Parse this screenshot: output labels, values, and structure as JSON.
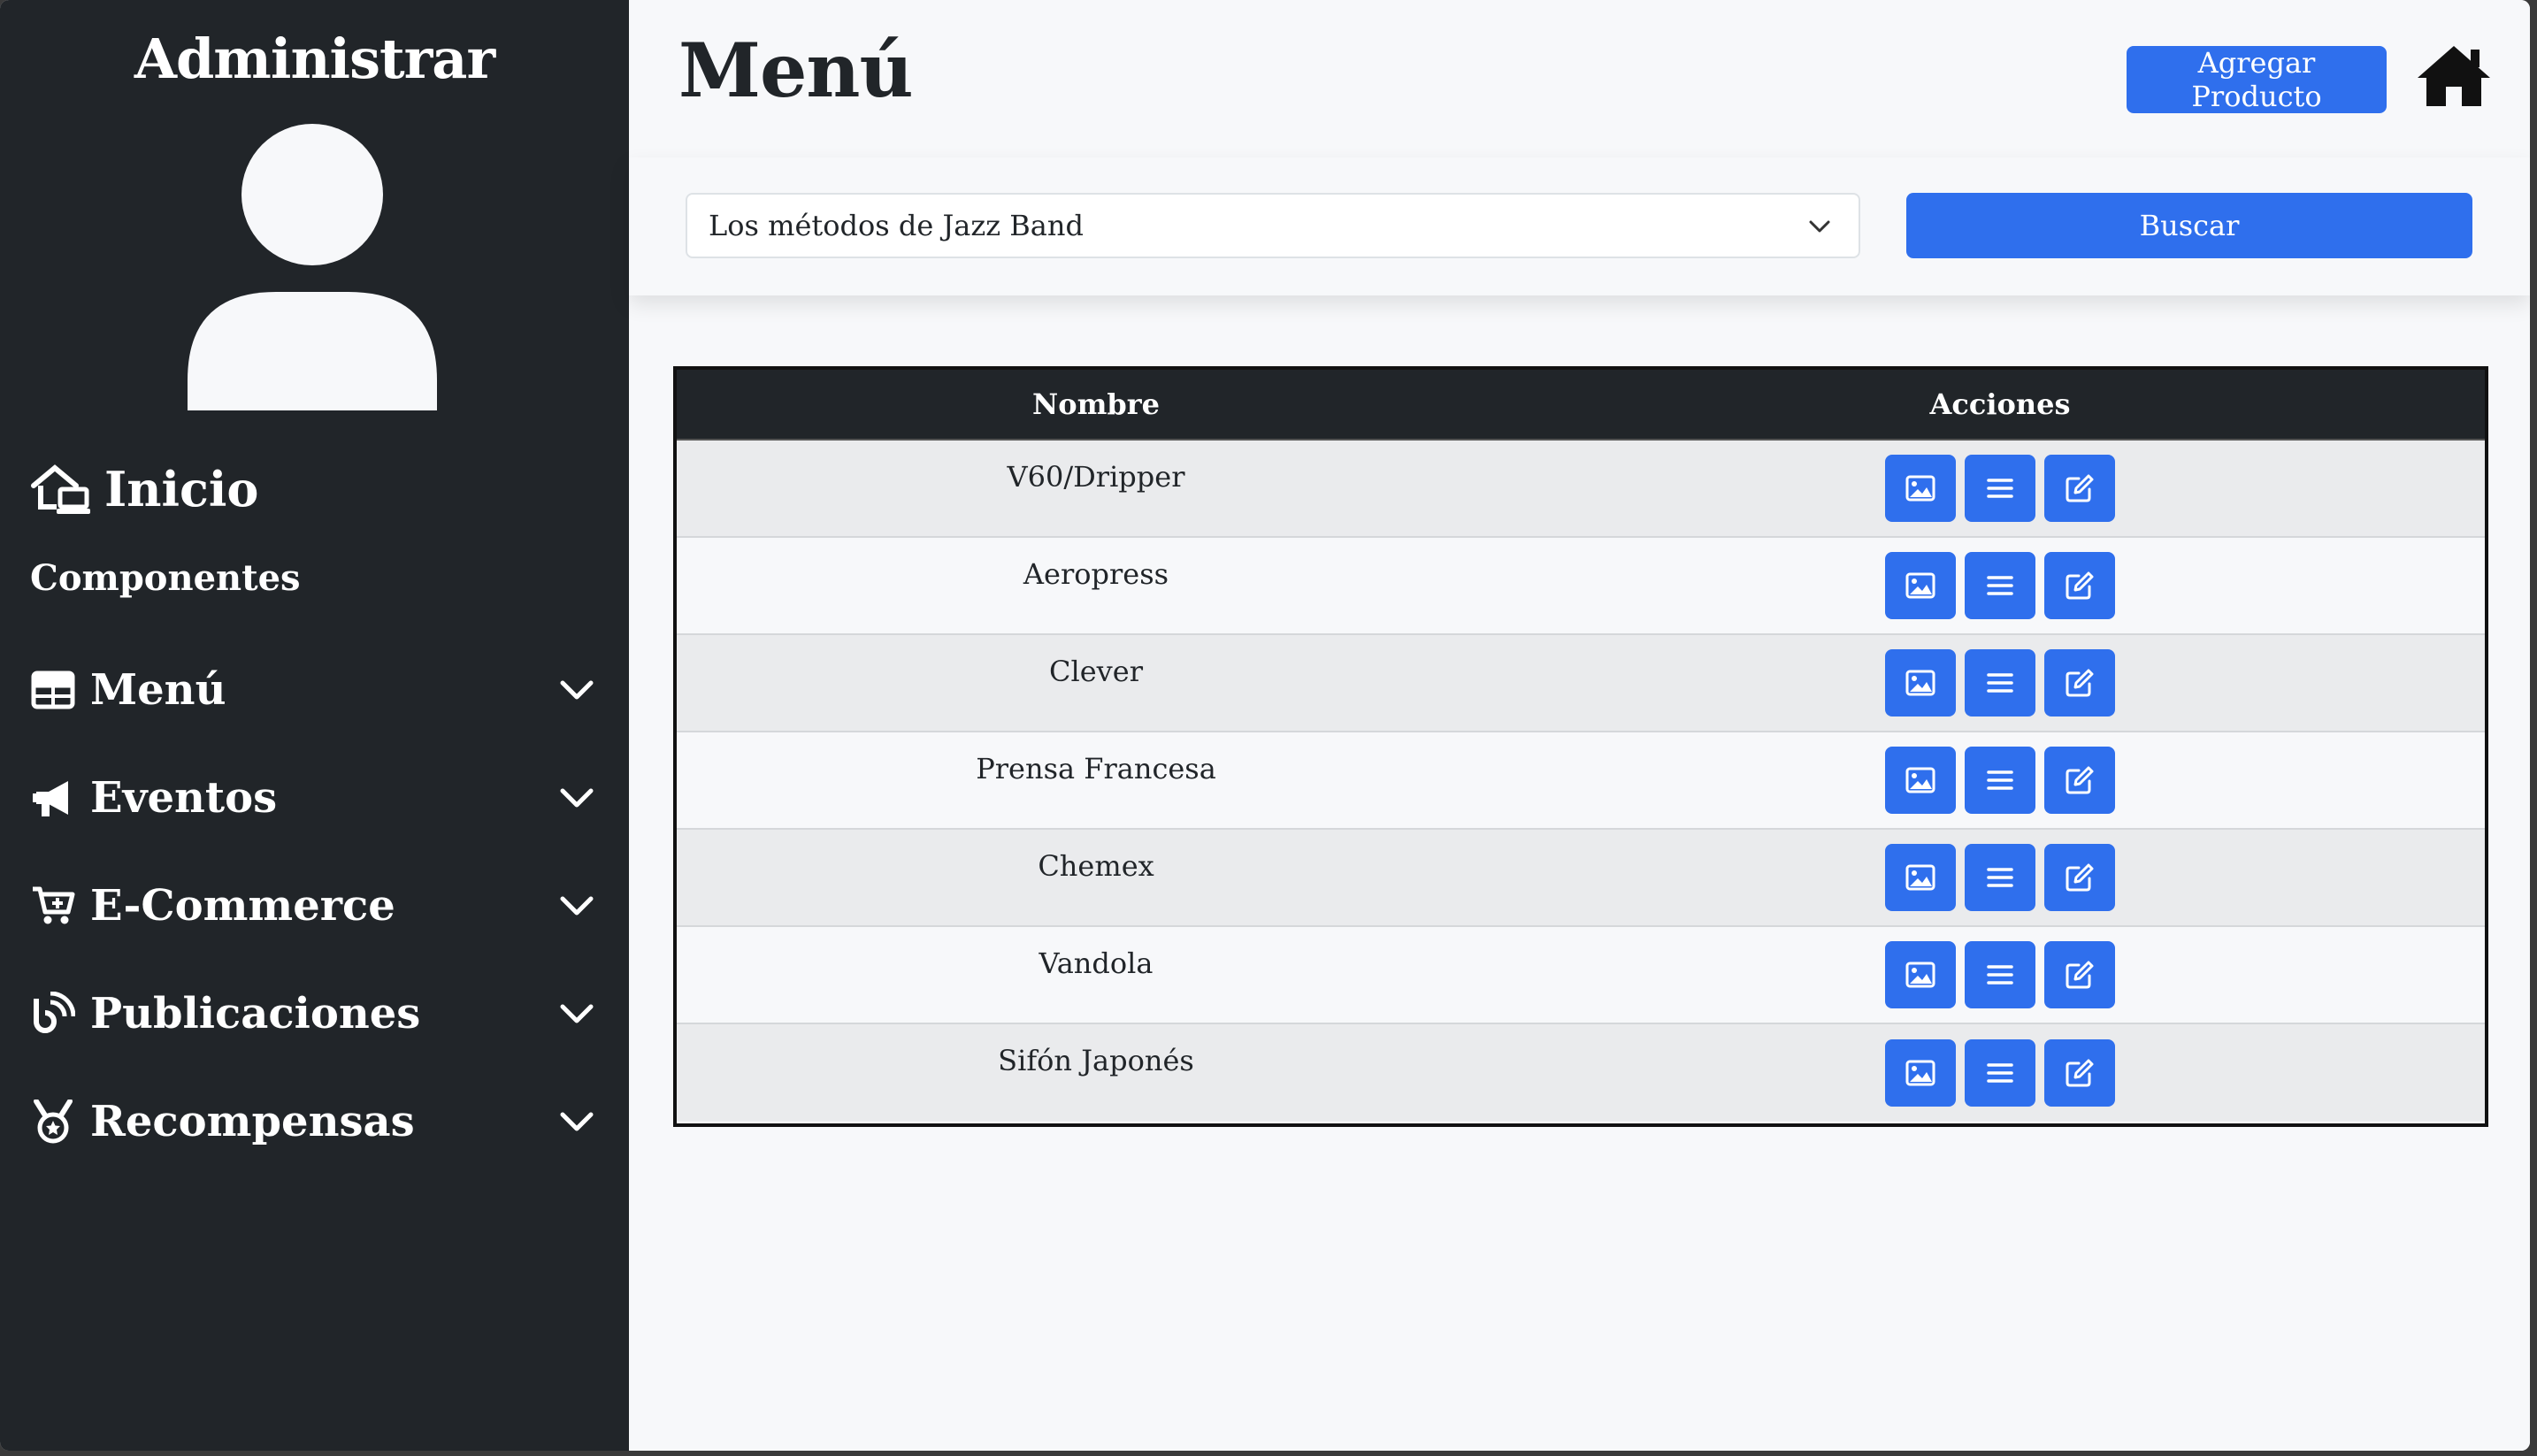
{
  "sidebar": {
    "title": "Administrar",
    "home_label": "Inicio",
    "section_label": "Componentes",
    "items": [
      {
        "label": "Menú",
        "icon": "table-icon"
      },
      {
        "label": "Eventos",
        "icon": "megaphone-icon"
      },
      {
        "label": "E-Commerce",
        "icon": "cart-icon"
      },
      {
        "label": "Publicaciones",
        "icon": "blog-icon"
      },
      {
        "label": "Recompensas",
        "icon": "medal-icon"
      }
    ]
  },
  "header": {
    "title": "Menú",
    "add_button": "Agregar Producto"
  },
  "search": {
    "selected_value": "Los métodos de Jazz Band",
    "button_label": "Buscar"
  },
  "table": {
    "columns": [
      "Nombre",
      "Acciones"
    ],
    "rows": [
      {
        "name": "V60/Dripper"
      },
      {
        "name": "Aeropress"
      },
      {
        "name": "Clever"
      },
      {
        "name": "Prensa Francesa"
      },
      {
        "name": "Chemex"
      },
      {
        "name": "Vandola"
      },
      {
        "name": "Sifón Japonés"
      }
    ],
    "action_icons": [
      "image-icon",
      "list-icon",
      "edit-icon"
    ]
  },
  "colors": {
    "sidebar_bg": "#212529",
    "accent": "#2f6fed",
    "main_bg": "#f7f8fa"
  }
}
